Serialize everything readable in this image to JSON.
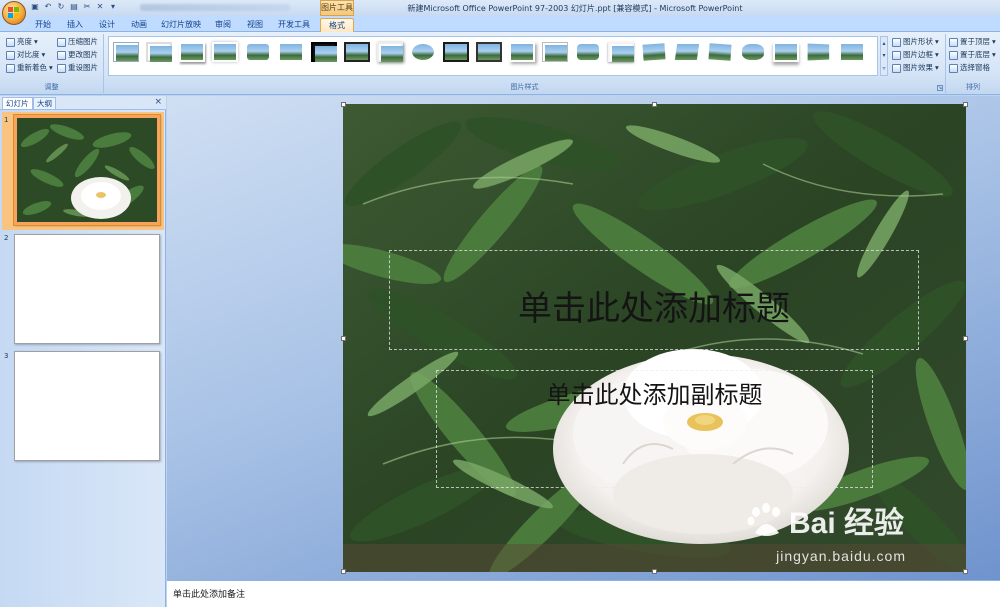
{
  "titlebar": {
    "window_title": "新建Microsoft Office PowerPoint 97-2003 幻灯片.ppt [兼容模式] - Microsoft PowerPoint",
    "context_tab": "图片工具",
    "qat_icons": [
      "save-icon",
      "undo-icon",
      "redo-icon",
      "print-preview-icon",
      "cut-icon",
      "delete-icon",
      "customize-icon"
    ]
  },
  "tabs": [
    "开始",
    "插入",
    "设计",
    "动画",
    "幻灯片放映",
    "审阅",
    "视图",
    "开发工具",
    "格式"
  ],
  "active_tab": "格式",
  "ribbon": {
    "adjust": {
      "title": "调整",
      "brightness": "亮度",
      "contrast": "对比度",
      "recolor": "重新着色",
      "compress": "压缩图片",
      "change": "更改图片",
      "reset": "重设图片"
    },
    "styles": {
      "title": "图片样式",
      "shape": "图片形状",
      "border": "图片边框",
      "effects": "图片效果"
    },
    "arrange": {
      "title": "排列",
      "bring_front": "置于顶层",
      "send_back": "置于底层",
      "selection_pane": "选择窗格"
    }
  },
  "left_panel": {
    "tab_slides": "幻灯片",
    "tab_outline": "大纲",
    "close": "×",
    "slides": [
      {
        "num": "1",
        "selected": true
      },
      {
        "num": "2",
        "selected": false
      },
      {
        "num": "3",
        "selected": false
      }
    ]
  },
  "slide": {
    "title_placeholder": "单击此处添加标题",
    "subtitle_placeholder": "单击此处添加副标题"
  },
  "watermark": {
    "brand": "Bai 经验",
    "url": "jingyan.baidu.com"
  },
  "notes": {
    "placeholder": "单击此处添加备注"
  }
}
